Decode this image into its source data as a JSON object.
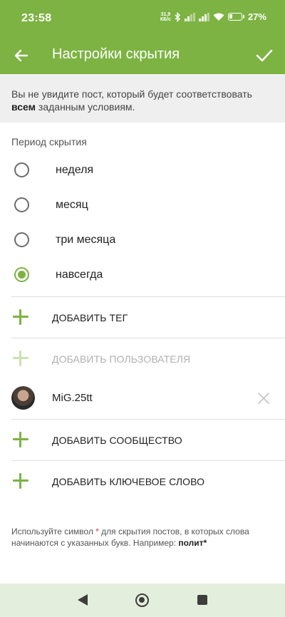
{
  "status": {
    "time": "23:58",
    "net_speed_value": "31,9",
    "net_speed_unit": "КБ/с",
    "battery_percent": "27%"
  },
  "appbar": {
    "title": "Настройки скрытия"
  },
  "info": {
    "text_before": "Вы не увидите пост, который будет соответствовать ",
    "bold": "всем",
    "text_after": " заданным условиям."
  },
  "period": {
    "label": "Период скрытия",
    "options": [
      {
        "label": "неделя",
        "selected": false
      },
      {
        "label": "месяц",
        "selected": false
      },
      {
        "label": "три месяца",
        "selected": false
      },
      {
        "label": "навсегда",
        "selected": true
      }
    ]
  },
  "actions": {
    "add_tag": "ДОБАВИТЬ ТЕГ",
    "add_user": "ДОБАВИТЬ ПОЛЬЗОВАТЕЛЯ",
    "add_community": "ДОБАВИТЬ СООБЩЕСТВО",
    "add_keyword": "ДОБАВИТЬ КЛЮЧЕВОЕ СЛОВО"
  },
  "user": {
    "name": "MiG.25tt"
  },
  "hint": {
    "part1": "Используйте символ ",
    "star": "*",
    "part2": " для скрытия постов, в которых слова начинаются с указанных букв. Например: ",
    "example": "полит*"
  },
  "colors": {
    "accent": "#7cb342",
    "navbar_bg": "#e3eedd",
    "info_bg": "#efefef",
    "star": "#e53935"
  }
}
